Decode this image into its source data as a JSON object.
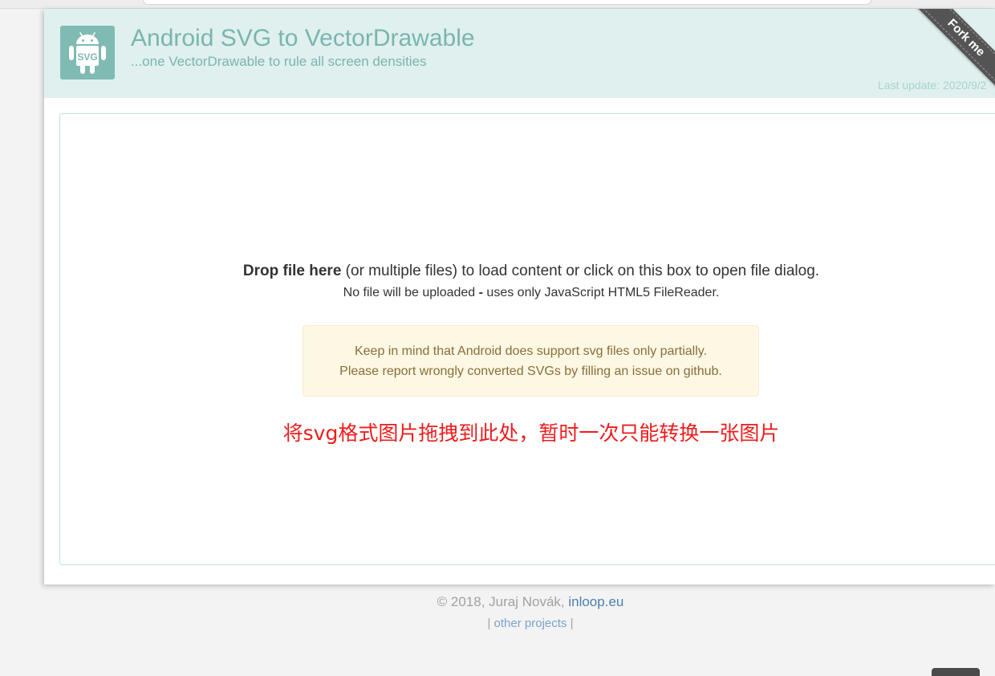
{
  "header": {
    "title": "Android SVG to VectorDrawable",
    "subtitle": "...one VectorDrawable to rule all screen densities",
    "last_update": "Last update: 2020/9/2",
    "logo_text": "SVG",
    "fork_ribbon": "Fork me"
  },
  "drop_zone": {
    "line1_bold": "Drop file here",
    "line1_rest": " (or multiple files) to load content or click on this box to open file dialog.",
    "line2_pre": "No file will be uploaded ",
    "line2_bold": "-",
    "line2_post": " uses only JavaScript HTML5 FileReader.",
    "notice_line1": "Keep in mind that Android does support svg files only partially.",
    "notice_line2": "Please report wrongly converted SVGs by filling an issue on github.",
    "annotation": "将svg格式图片拖拽到此处，暂时一次只能转换一张图片"
  },
  "footer": {
    "copyright": "© 2018, Juraj Novák, ",
    "author_link": "inloop.eu",
    "sep_left": "| ",
    "other_projects": "other projects",
    "sep_right": " |"
  },
  "colors": {
    "header_bg": "#dff0ef",
    "accent": "#7ab5af",
    "notice_bg": "#fcf8e3",
    "notice_text": "#8a6d3b",
    "annotation": "#ee1c1c",
    "link": "#4c7fb3"
  },
  "icons": {
    "logo": "android-svg-logo-icon"
  }
}
